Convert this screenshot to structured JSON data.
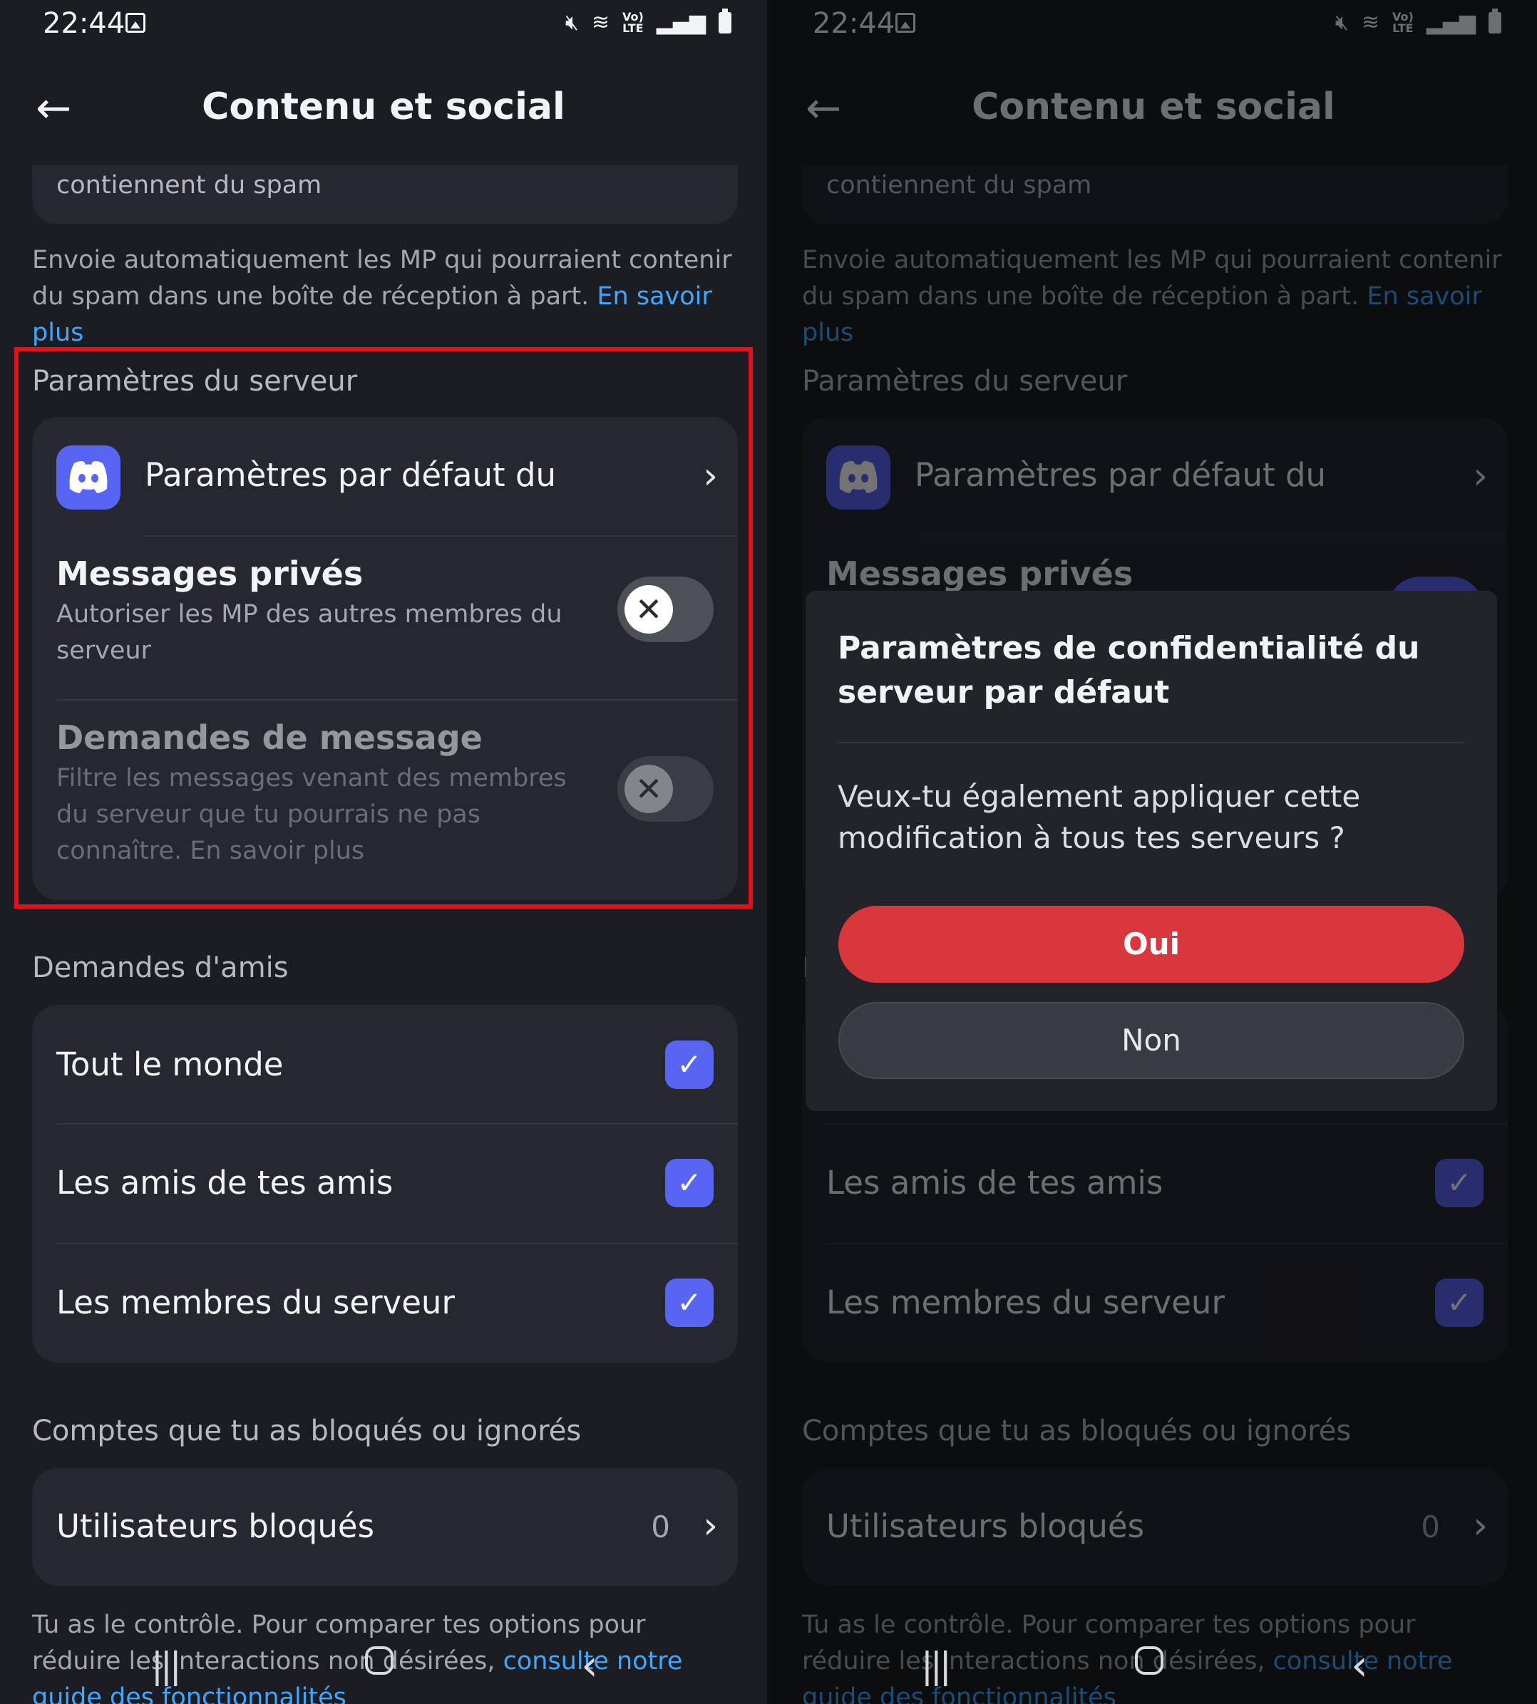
{
  "status_bar": {
    "time": "22:44"
  },
  "header": {
    "title": "Contenu et social"
  },
  "spam": {
    "card_text": "contiennent du spam",
    "description": "Envoie automatiquement les MP qui pourraient contenir du spam dans une boîte de réception à part.",
    "link": "En savoir plus"
  },
  "server_settings": {
    "section_label": "Paramètres du serveur",
    "defaults_label": "Paramètres par défaut du",
    "dm": {
      "title": "Messages privés",
      "subtitle": "Autoriser les MP des autres membres du serveur",
      "enabled": false
    },
    "message_requests": {
      "title": "Demandes de message",
      "subtitle": "Filtre les messages venant des membres du serveur que tu pourrais ne pas connaître. En savoir plus",
      "enabled": false,
      "disabled": true
    }
  },
  "friend_requests": {
    "section_label": "Demandes d'amis",
    "options": [
      {
        "label": "Tout le monde",
        "checked": true
      },
      {
        "label": "Les amis de tes amis",
        "checked": true
      },
      {
        "label": "Les membres du serveur",
        "checked": true
      }
    ]
  },
  "blocked": {
    "section_label": "Comptes que tu as bloqués ou ignorés",
    "users_label": "Utilisateurs bloqués",
    "count": "0",
    "footer_text": "Tu as le contrôle. Pour comparer tes options pour réduire les interactions non désirées,",
    "footer_link": "consulte notre guide des fonctionnalités"
  },
  "dialog": {
    "title": "Paramètres de confidentialité du serveur par défaut",
    "message": "Veux-tu également appliquer cette modification à tous tes serveurs ?",
    "yes_label": "Oui",
    "no_label": "Non"
  },
  "colors": {
    "accent": "#5865f2",
    "danger": "#da373c",
    "link": "#3ea8ff",
    "highlight": "#e4101c"
  }
}
